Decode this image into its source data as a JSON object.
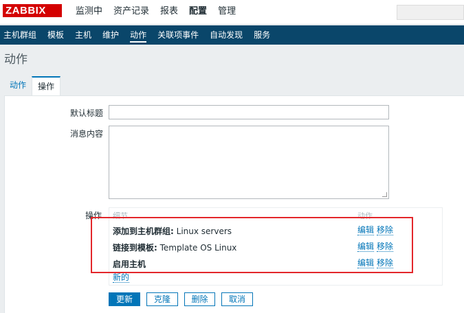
{
  "header": {
    "logo": "ZABBIX",
    "menu": [
      "监测中",
      "资产记录",
      "报表",
      "配置",
      "管理"
    ],
    "active_menu_index": 3
  },
  "submenu": {
    "items": [
      "主机群组",
      "模板",
      "主机",
      "维护",
      "动作",
      "关联项事件",
      "自动发现",
      "服务"
    ],
    "active_index": 4
  },
  "page": {
    "title": "动作"
  },
  "tabs": [
    "动作",
    "操作"
  ],
  "form": {
    "default_subject_label": "默认标题",
    "default_subject_value": "",
    "message_label": "消息内容",
    "message_value": "",
    "operations_label": "操作"
  },
  "operations": {
    "col_details": "细节",
    "col_action": "动作",
    "rows": [
      {
        "bold": "添加到主机群组:",
        "text": " Linux servers"
      },
      {
        "bold": "链接到模板:",
        "text": " Template OS Linux"
      },
      {
        "bold": "启用主机",
        "text": ""
      }
    ],
    "edit_label": "编辑",
    "remove_label": "移除",
    "new_label": "新的"
  },
  "buttons": {
    "update": "更新",
    "clone": "克隆",
    "delete": "删除",
    "cancel": "取消"
  },
  "colors": {
    "logo_red": "#d40000",
    "nav_blue": "#0a466a",
    "link_blue": "#0275b8",
    "highlight_red": "#e3262a"
  }
}
